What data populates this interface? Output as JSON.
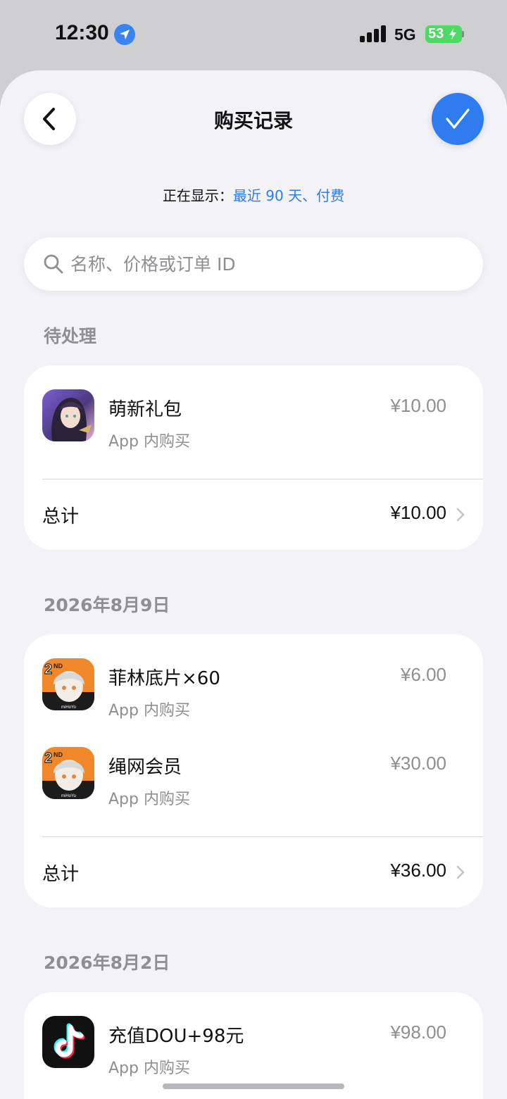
{
  "status_bar": {
    "time": "12:30",
    "network": "5G",
    "battery": "53"
  },
  "nav": {
    "title": "购买记录"
  },
  "filter": {
    "prefix": "正在显示：",
    "value": "最近 90 天、付费"
  },
  "search": {
    "placeholder": "名称、价格或订单 ID"
  },
  "sections": [
    {
      "header": "待处理",
      "items": [
        {
          "name": "萌新礼包",
          "type": "App 内购买",
          "price": "¥10.00",
          "icon": "anime-character-app-icon"
        }
      ],
      "total_label": "总计",
      "total": "¥10.00"
    },
    {
      "header": "2026年8月9日",
      "items": [
        {
          "name": "菲林底片×60",
          "type": "App 内购买",
          "price": "¥6.00",
          "icon": "zenless-app-icon"
        },
        {
          "name": "绳网会员",
          "type": "App 内购买",
          "price": "¥30.00",
          "icon": "zenless-app-icon"
        }
      ],
      "total_label": "总计",
      "total": "¥36.00"
    },
    {
      "header": "2026年8月2日",
      "items": [
        {
          "name": "充值DOU+98元",
          "type": "App 内购买",
          "price": "¥98.00",
          "icon": "tiktok-app-icon"
        }
      ]
    }
  ],
  "colors": {
    "accent": "#2f7cf0",
    "background": "#f2f2f7",
    "secondary_text": "#8e8e93"
  }
}
